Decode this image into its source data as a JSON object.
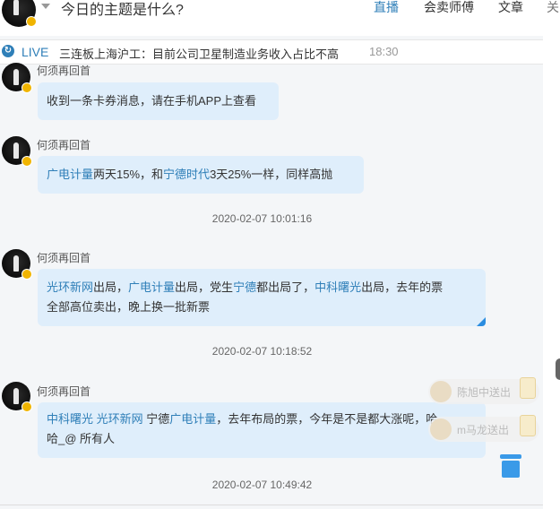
{
  "header": {
    "topic": "今日的主题是什么?",
    "nav": [
      "直播",
      "会卖师傅",
      "文章",
      "关"
    ]
  },
  "live": {
    "label": "LIVE",
    "headline": "三连板上海沪工：目前公司卫星制造业务收入占比不高",
    "time": "18:30"
  },
  "messages": [
    {
      "sender": "何须再回首",
      "text": "收到一条卡券消息，请在手机APP上查看"
    },
    {
      "sender": "何须再回首",
      "parts": [
        "广电计量",
        "两天15%，和",
        "宁德时代",
        "3天25%一样，同样高抛"
      ]
    },
    {
      "time": "2020-02-07 10:01:16"
    },
    {
      "sender": "何须再回首",
      "parts": [
        "光环新网",
        "出局，",
        "广电计量",
        "出局，党生",
        "宁德",
        "都出局了，",
        "中科曙光",
        "出局，去年的票",
        "全部高位卖出，晚上换一批新票"
      ]
    },
    {
      "time": "2020-02-07 10:18:52"
    },
    {
      "sender": "何须再回首",
      "parts": [
        "中科曙光",
        " ",
        "光环新网",
        " 宁德",
        "广电计量",
        "，去年布局的票，今年是不是都大涨呢，哈",
        "哈_@ 所有人"
      ]
    },
    {
      "time": "2020-02-07 10:49:42"
    }
  ],
  "gifts": [
    {
      "name": "陈旭中送出"
    },
    {
      "name": "m马龙送出"
    }
  ],
  "icons": {
    "live": "live-icon",
    "trash": "trash-icon",
    "dropdown": "chevron-down-icon"
  },
  "colors": {
    "accent": "#2f7fb8",
    "bubble": "#dfeefb"
  }
}
